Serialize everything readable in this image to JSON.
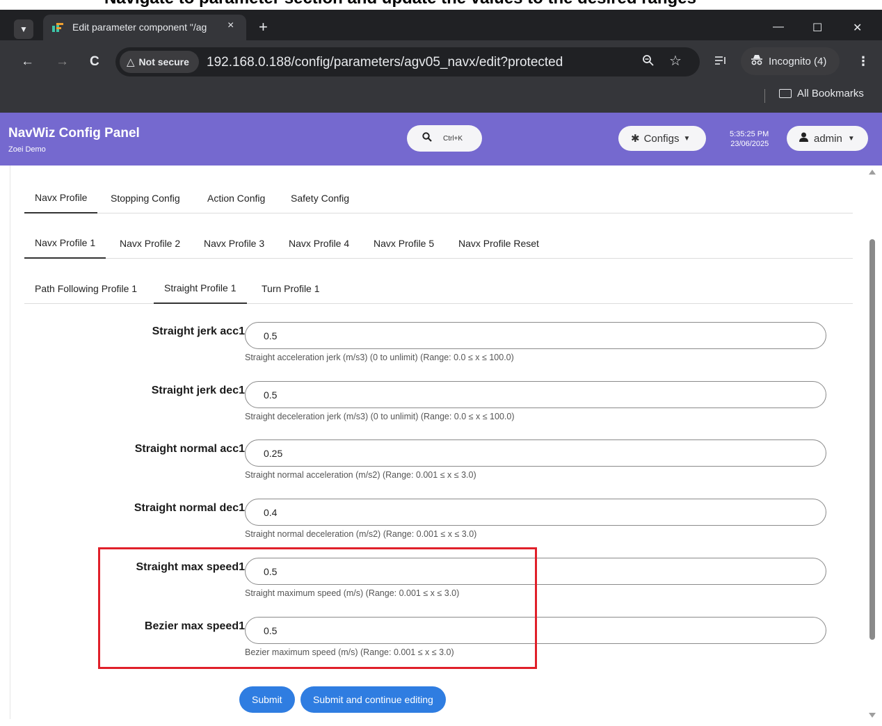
{
  "caption": "Navigate to parameter section and update the values to the desired ranges",
  "browser": {
    "tab_title": "Edit parameter component \"/ag",
    "tab_close": "×",
    "new_tab": "+",
    "window_controls": {
      "minimize": "—",
      "maximize": "☐",
      "close": "✕"
    },
    "nav": {
      "back": "←",
      "forward": "→",
      "reload": "C"
    },
    "security_label": "Not secure",
    "url": "192.168.0.188/config/parameters/agv05_navx/edit?protected",
    "incognito_label": "Incognito (4)",
    "menu_icon": "⋮",
    "bookmarks_label": "All Bookmarks"
  },
  "app": {
    "title": "NavWiz Config Panel",
    "subtitle": "Zoei Demo",
    "search_shortcut": "Ctrl+K",
    "configs_label": "Configs",
    "time": "5:35:25 PM",
    "date": "23/06/2025",
    "user": "admin"
  },
  "tabs_level1": [
    {
      "label": "Navx Profile",
      "active": true
    },
    {
      "label": "Stopping Config",
      "active": false
    },
    {
      "label": "Action Config",
      "active": false
    },
    {
      "label": "Safety Config",
      "active": false
    }
  ],
  "tabs_level2": [
    {
      "label": "Navx Profile 1",
      "active": true
    },
    {
      "label": "Navx Profile 2",
      "active": false
    },
    {
      "label": "Navx Profile 3",
      "active": false
    },
    {
      "label": "Navx Profile 4",
      "active": false
    },
    {
      "label": "Navx Profile 5",
      "active": false
    },
    {
      "label": "Navx Profile Reset",
      "active": false
    }
  ],
  "tabs_level3": [
    {
      "label": "Path Following Profile 1",
      "active": false
    },
    {
      "label": "Straight Profile 1",
      "active": true
    },
    {
      "label": "Turn Profile 1",
      "active": false
    }
  ],
  "fields": [
    {
      "label": "Straight jerk acc1",
      "value": "0.5",
      "help": "Straight acceleration jerk (m/s3) (0 to unlimit) (Range: 0.0 ≤ x ≤ 100.0)"
    },
    {
      "label": "Straight jerk dec1",
      "value": "0.5",
      "help": "Straight deceleration jerk (m/s3) (0 to unlimit) (Range: 0.0 ≤ x ≤ 100.0)"
    },
    {
      "label": "Straight normal acc1",
      "value": "0.25",
      "help": "Straight normal acceleration (m/s2) (Range: 0.001 ≤ x ≤ 3.0)"
    },
    {
      "label": "Straight normal dec1",
      "value": "0.4",
      "help": "Straight normal deceleration (m/s2) (Range: 0.001 ≤ x ≤ 3.0)"
    },
    {
      "label": "Straight max speed1",
      "value": "0.5",
      "help": "Straight maximum speed (m/s) (Range: 0.001 ≤ x ≤ 3.0)"
    },
    {
      "label": "Bezier max speed1",
      "value": "0.5",
      "help": "Bezier maximum speed (m/s) (Range: 0.001 ≤ x ≤ 3.0)"
    }
  ],
  "actions": {
    "submit": "Submit",
    "submit_continue": "Submit and continue editing"
  },
  "colors": {
    "header": "#7569cf",
    "primary_button": "#2f7de1",
    "highlight": "#e0202a",
    "chrome_dark": "#202124"
  }
}
